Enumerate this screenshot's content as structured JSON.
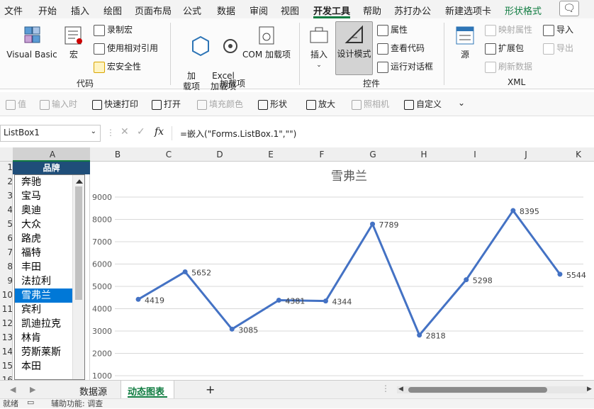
{
  "ribbon_tabs": [
    "文件",
    "开始",
    "插入",
    "绘图",
    "页面布局",
    "公式",
    "数据",
    "审阅",
    "视图",
    "开发工具",
    "帮助",
    "苏打办公",
    "新建选项卡",
    "形状格式"
  ],
  "active_tab": "开发工具",
  "comment_icon": "comment-icon",
  "groups": {
    "code": {
      "label": "代码",
      "visual_basic": "Visual Basic",
      "macros": "宏",
      "record_macro": "录制宏",
      "relative_ref": "使用相对引用",
      "macro_security": "宏安全性"
    },
    "addins": {
      "label": "加载项",
      "addins": "加\n载项",
      "excel_addins": "Excel\n加载项",
      "com_addins": "COM 加载项"
    },
    "controls": {
      "label": "控件",
      "insert": "插入",
      "design_mode": "设计模式",
      "properties": "属性",
      "view_code": "查看代码",
      "run_dialog": "运行对话框"
    },
    "xml": {
      "label": "XML",
      "source": "源",
      "map_properties": "映射属性",
      "expansion_packs": "扩展包",
      "refresh_data": "刷新数据",
      "import": "导入",
      "export": "导出"
    }
  },
  "qat": [
    "值",
    "输入时",
    "快速打印",
    "打开",
    "填充颜色",
    "形状",
    "放大",
    "照相机",
    "自定义"
  ],
  "qat_disabled": [
    true,
    true,
    false,
    false,
    true,
    false,
    false,
    true,
    false
  ],
  "name_box": "ListBox1",
  "fx_label": "fx",
  "formula": "=嵌入(\"Forms.ListBox.1\",\"\")",
  "columns": [
    "A",
    "B",
    "C",
    "D",
    "E",
    "F",
    "G",
    "H",
    "I",
    "J",
    "K"
  ],
  "rows": [
    "1",
    "2",
    "3",
    "4",
    "5",
    "6",
    "7",
    "8",
    "9",
    "10",
    "11",
    "12",
    "13",
    "14",
    "15",
    "16"
  ],
  "brand_header": "品牌",
  "listbox": {
    "items": [
      "奔驰",
      "宝马",
      "奥迪",
      "大众",
      "路虎",
      "福特",
      "丰田",
      "法拉利",
      "雪弗兰",
      "宾利",
      "凯迪拉克",
      "林肯",
      "劳斯莱斯",
      "本田"
    ],
    "selected_index": 8
  },
  "chart_data": {
    "type": "line",
    "title": "雪弗兰",
    "values": [
      4419,
      5652,
      3085,
      4381,
      4344,
      7789,
      2818,
      5298,
      8395,
      5544
    ],
    "ylim": [
      1000,
      9000
    ],
    "yticks": [
      1000,
      2000,
      3000,
      4000,
      5000,
      6000,
      7000,
      8000,
      9000
    ],
    "grid": true,
    "color": "#4472c4"
  },
  "sheet_tabs": [
    "数据源",
    "动态图表"
  ],
  "active_sheet": "动态图表",
  "add_sheet": "+",
  "status": {
    "ready": "就绪",
    "accessibility": "辅助功能: 调查"
  }
}
